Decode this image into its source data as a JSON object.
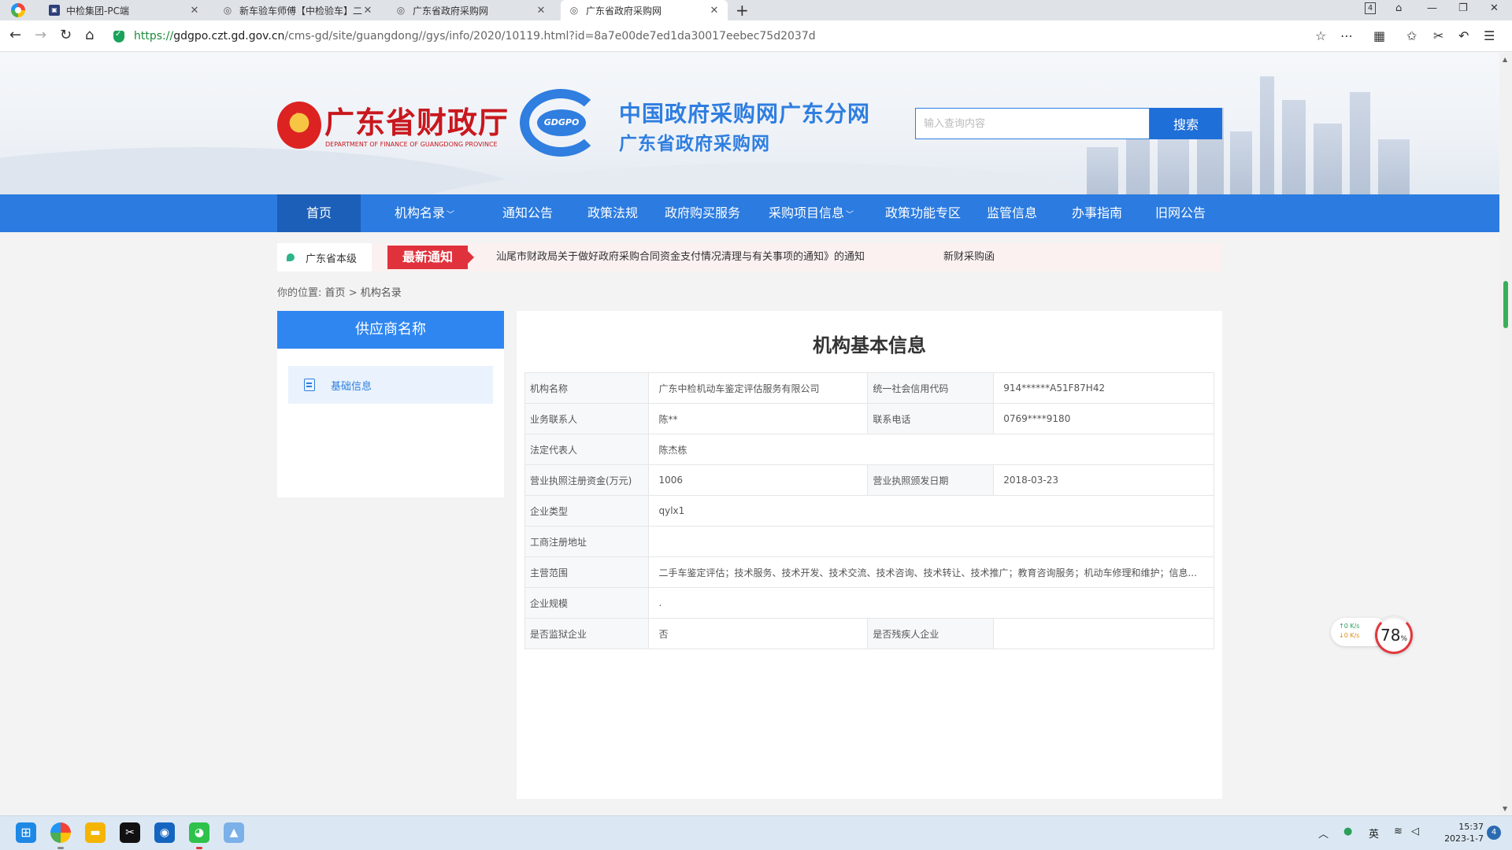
{
  "browser": {
    "tabs": [
      {
        "title": "中检集团-PC端",
        "favicon": "site-square-icon",
        "active": false
      },
      {
        "title": "新车验车师傅【中检验车】二",
        "favicon": "globe-icon",
        "active": false
      },
      {
        "title": "广东省政府采购网",
        "favicon": "globe-icon",
        "active": false
      },
      {
        "title": "广东省政府采购网",
        "favicon": "globe-icon",
        "active": true
      }
    ],
    "tab_count": "4",
    "url": {
      "protocol": "https://",
      "host": "gdgpo.czt.gd.gov.cn",
      "path": "/cms-gd/site/guangdong//gys/info/2020/10119.html?id=8a7e00de7ed1da30017eebec75d2037d"
    }
  },
  "header": {
    "department_title": "广东省财政厅",
    "department_subtitle": "DEPARTMENT OF FINANCE OF GUANGDONG PROVINCE",
    "logo_text": "GDGPO",
    "site_title": "中国政府采购网广东分网",
    "site_subtitle": "广东省政府采购网",
    "search_placeholder": "输入查询内容",
    "search_button": "搜索"
  },
  "nav": [
    {
      "label": "首页",
      "active": true,
      "dropdown": false
    },
    {
      "label": "机构名录",
      "active": false,
      "dropdown": true
    },
    {
      "label": "通知公告",
      "active": false,
      "dropdown": false
    },
    {
      "label": "政策法规",
      "active": false,
      "dropdown": false
    },
    {
      "label": "政府购买服务",
      "active": false,
      "dropdown": false
    },
    {
      "label": "采购项目信息",
      "active": false,
      "dropdown": true
    },
    {
      "label": "政策功能专区",
      "active": false,
      "dropdown": false
    },
    {
      "label": "监管信息",
      "active": false,
      "dropdown": false
    },
    {
      "label": "办事指南",
      "active": false,
      "dropdown": false
    },
    {
      "label": "旧网公告",
      "active": false,
      "dropdown": false
    }
  ],
  "notice": {
    "region": "广东省本级",
    "badge": "最新通知",
    "text": "汕尾市财政局关于做好政府采购合同资金支付情况清理与有关事项的通知》的通知",
    "text2": "新财采购函"
  },
  "breadcrumb": {
    "prefix": "你的位置:",
    "home": "首页",
    "separator": ">",
    "current": "机构名录"
  },
  "sidebar": {
    "heading": "供应商名称",
    "item": "基础信息"
  },
  "content": {
    "title": "机构基本信息",
    "rows": [
      {
        "l1": "机构名称",
        "v1": "广东中检机动车鉴定评估服务有限公司",
        "l2": "统一社会信用代码",
        "v2": "914******A51F87H42"
      },
      {
        "l1": "业务联系人",
        "v1": "陈**",
        "l2": "联系电话",
        "v2": "0769****9180"
      },
      {
        "l1": "法定代表人",
        "v1": "陈杰栋"
      },
      {
        "l1": "营业执照注册资金(万元)",
        "v1": "1006",
        "l2": "营业执照颁发日期",
        "v2": "2018-03-23"
      },
      {
        "l1": "企业类型",
        "v1": "qylx1"
      },
      {
        "l1": "工商注册地址",
        "v1": ""
      },
      {
        "l1": "主营范围",
        "v1": "二手车鉴定评估；技术服务、技术开发、技术交流、技术咨询、技术转让、技术推广；教育咨询服务；机动车修理和维护；信息..."
      },
      {
        "l1": "企业规模",
        "v1": "."
      },
      {
        "l1": "是否监狱企业",
        "v1": "否",
        "l2": "是否残疾人企业",
        "v2": ""
      }
    ]
  },
  "net_widget": {
    "up": "↑0  K/s",
    "down": "↓0  K/s",
    "percent": "78",
    "percent_unit": "%"
  },
  "taskbar": {
    "ime": "英",
    "time": "15:37",
    "date": "2023-1-7",
    "notifications": "4"
  }
}
